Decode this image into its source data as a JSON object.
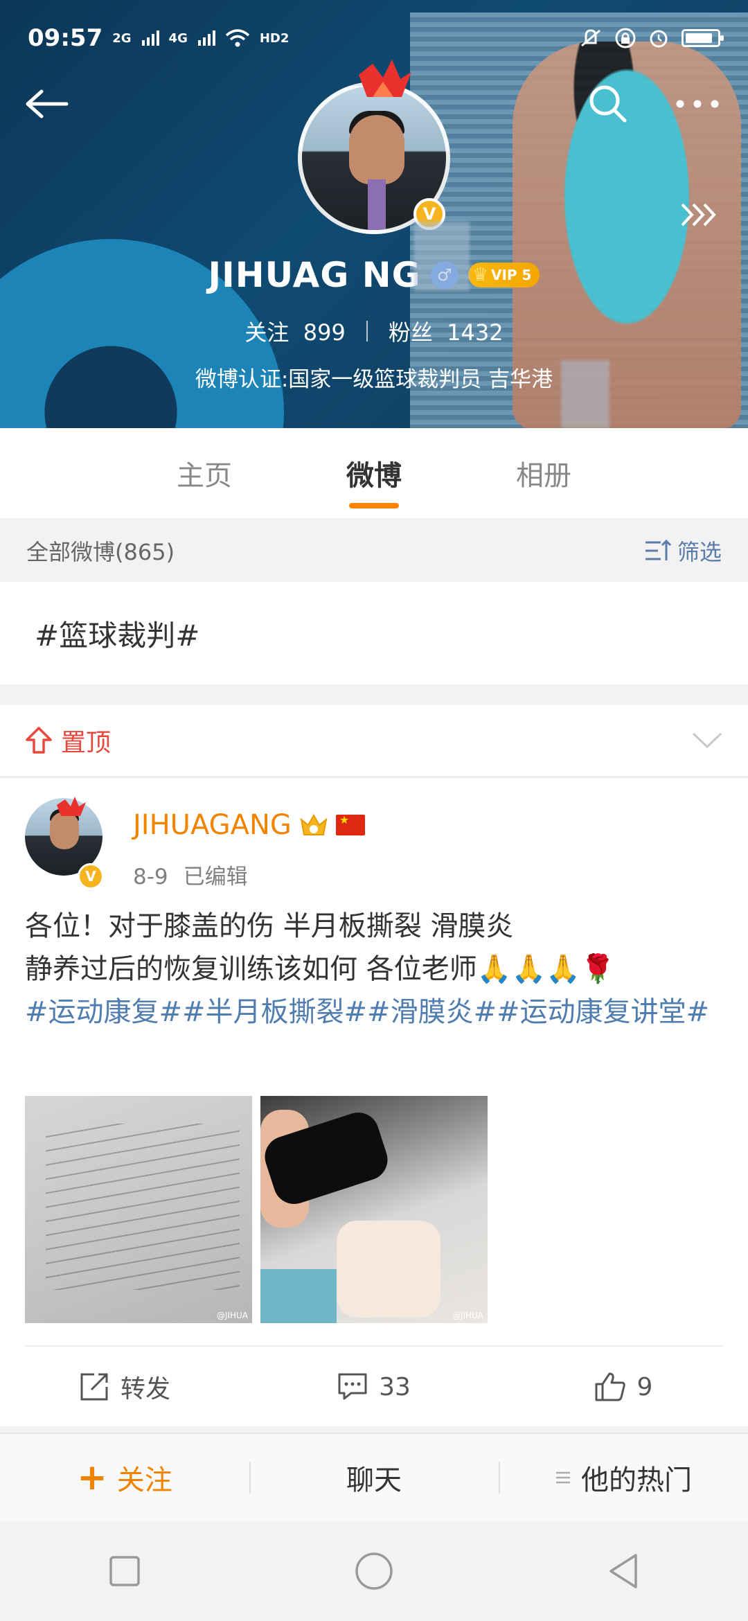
{
  "status_bar": {
    "time": "09:57",
    "network_1": "2G",
    "network_2": "4G",
    "hd": "HD2"
  },
  "profile": {
    "name": "JIHUAGANG",
    "name_visible": "JIHUAG    NG",
    "vip_label": "VIP 5",
    "following_label": "关注",
    "following_count": "899",
    "followers_label": "粉丝",
    "followers_count": "1432",
    "verification": "微博认证:国家一级篮球裁判员 吉华港",
    "verified_mark": "V"
  },
  "tabs": [
    {
      "label": "主页",
      "active": false
    },
    {
      "label": "微博",
      "active": true
    },
    {
      "label": "相册",
      "active": false
    }
  ],
  "filter": {
    "count_label": "全部微博(865)",
    "filter_label": "筛选"
  },
  "topic": "#篮球裁判#",
  "pinned": {
    "label": "置顶"
  },
  "post": {
    "author": "JIHUAGANG",
    "date": "8-9",
    "edited": "已编辑",
    "line1": "各位！对于膝盖的伤 半月板撕裂 滑膜炎",
    "line2": "静养过后的恢复训练该如何 各位老师",
    "emoji": "🙏🙏🙏🌹",
    "tags": "#运动康复##半月板撕裂##滑膜炎##运动康复讲堂#",
    "watermark": "@JIHUA",
    "repost_label": "转发",
    "comment_count": "33",
    "like_count": "9"
  },
  "bottom_bar": {
    "follow_label": "关注",
    "chat_label": "聊天",
    "hot_label": "他的热门"
  },
  "colors": {
    "accent": "#ff8200",
    "username": "#f08300",
    "link": "#507daf",
    "pinned": "#e8473d"
  }
}
